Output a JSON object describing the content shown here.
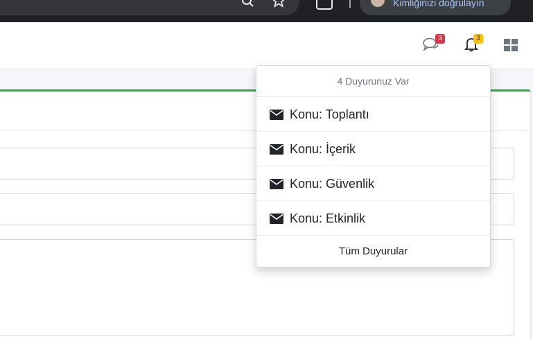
{
  "browser": {
    "profile_label": "Kimliğinizi doğrulayın",
    "icons": [
      "search-icon",
      "star-icon",
      "extensions-icon",
      "profile-avatar",
      "kebab-menu-icon"
    ]
  },
  "navbar": {
    "messages_badge": "3",
    "notifications_badge": "3",
    "icons": [
      "comments-icon",
      "bell-icon",
      "apps-grid-icon"
    ],
    "colors": {
      "messages_badge": "#dc3545",
      "notifications_badge": "#ffc107"
    }
  },
  "page": {
    "accent_color": "#28a745"
  },
  "notifications_dropdown": {
    "header": "4 Duyurunuz Var",
    "items": [
      {
        "label": "Konu: Toplantı",
        "icon": "envelope-icon"
      },
      {
        "label": "Konu: İçerik",
        "icon": "envelope-icon"
      },
      {
        "label": "Konu: Güvenlik",
        "icon": "envelope-icon"
      },
      {
        "label": "Konu: Etkinlik",
        "icon": "envelope-icon"
      }
    ],
    "footer": "Tüm Duyurular"
  }
}
